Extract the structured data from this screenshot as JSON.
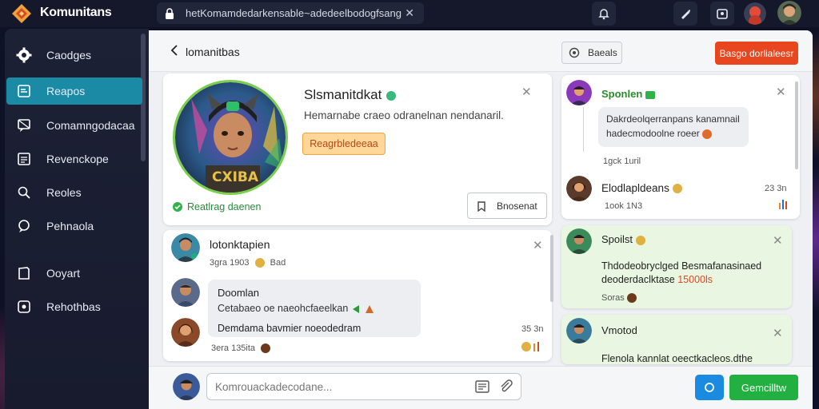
{
  "app": {
    "title": "Komunitans"
  },
  "urlbar": {
    "text": "hetKomamdedarkensable~adedeelbodogfsang"
  },
  "sidebar": {
    "items": [
      {
        "label": "Caodges",
        "icon": "gear-icon"
      },
      {
        "label": "Reapos",
        "icon": "clipboard-icon"
      },
      {
        "label": "Comamngodacaa",
        "icon": "chat-icon"
      },
      {
        "label": "Revenckope",
        "icon": "document-icon"
      },
      {
        "label": "Reoles",
        "icon": "search-icon"
      },
      {
        "label": "Pehnaola",
        "icon": "chat-bubble-icon"
      },
      {
        "label": "Ooyart",
        "icon": "folder-icon"
      },
      {
        "label": "Rehothbas",
        "icon": "box-icon"
      }
    ]
  },
  "header": {
    "title": "lomanitbas",
    "secondary_button": "Baeals",
    "primary_button": "Basgo dorlialeesr"
  },
  "profile": {
    "name": "Slsmanitdkat",
    "bio": "Hemarnabe craeo odranelnan nendanaril.",
    "tag": "Reagrbledeeaa",
    "status": "Reatlrag daenen",
    "action_button": "Bnosenat",
    "badge_text": "CXIBA"
  },
  "thread": {
    "title": "lotonktapien",
    "title_meta": "3gra 1903",
    "title_meta_extra": "Bad",
    "message1": {
      "title": "Doomlan",
      "line1": "Cetabaeo oe naeohcfaeelkan"
    },
    "message2": {
      "line": "Demdama bavmier noeodedram",
      "time": "35 3n",
      "meta": "3era 135ita"
    }
  },
  "right_panel": {
    "card1": {
      "name": "Sponlen",
      "text_line1": "Dakrdeolqerranpans kanamnail",
      "text_line2": "hadecmodoolne roeer",
      "meta1": "1gck 1uril",
      "row_name": "Elodlapldeans",
      "row_meta": "1ook 1N3",
      "row_time": "23 3n"
    },
    "card2": {
      "name": "Spoilst",
      "text_line1": "Thdodeobryclged Besmafanasinaed",
      "text_line2": "deoderdaclktase",
      "text_highlight": "15000ls",
      "meta": "Soras"
    },
    "card3": {
      "name": "Vmotod",
      "text": "Flenola kannlat oeectkacleos.dthe"
    }
  },
  "composer": {
    "placeholder": "Komrouackadecodane...",
    "send_label": "Gemcilltw"
  }
}
